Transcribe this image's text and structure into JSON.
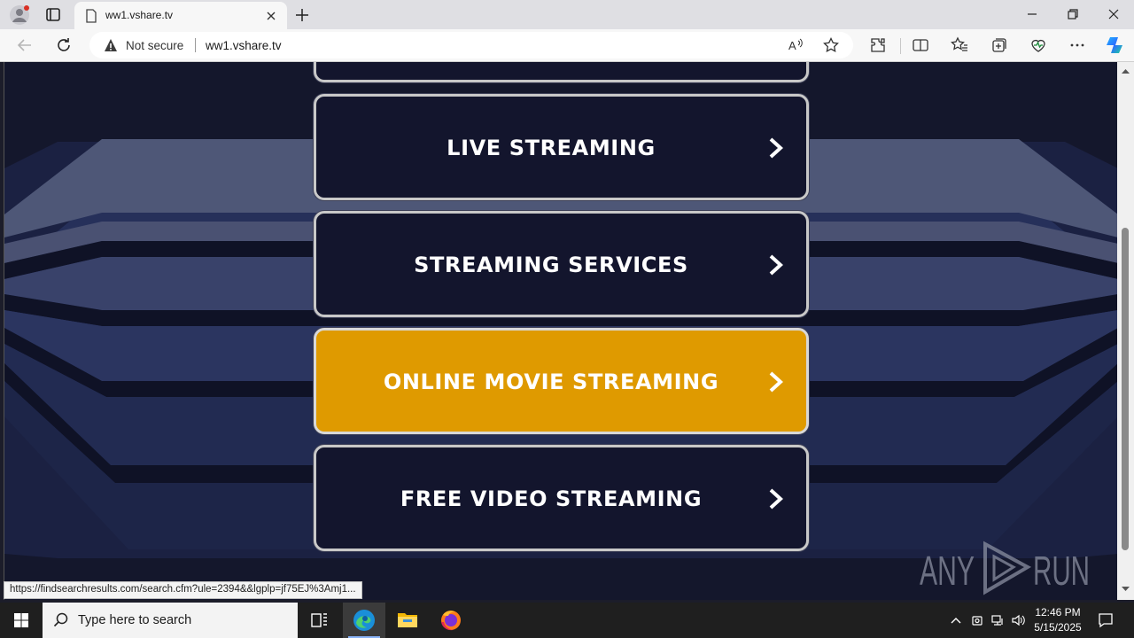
{
  "browser": {
    "tab_title": "ww1.vshare.tv",
    "security_label": "Not secure",
    "url": "ww1.vshare.tv"
  },
  "page": {
    "menu": [
      {
        "label": "LIVE STREAMING",
        "active": false
      },
      {
        "label": "STREAMING SERVICES",
        "active": false
      },
      {
        "label": "ONLINE MOVIE STREAMING",
        "active": true
      },
      {
        "label": "FREE VIDEO STREAMING",
        "active": false
      }
    ],
    "accent_color": "#df9a00",
    "status_url": "https://findsearchresults.com/search.cfm?ule=2394&&lgplp=jf75EJ%3Amj1...",
    "watermark": "ANY RUN"
  },
  "taskbar": {
    "search_placeholder": "Type here to search",
    "time": "12:46 PM",
    "date": "5/15/2025",
    "apps": [
      "task-view-icon",
      "edge-icon",
      "file-explorer-icon",
      "firefox-icon"
    ]
  }
}
